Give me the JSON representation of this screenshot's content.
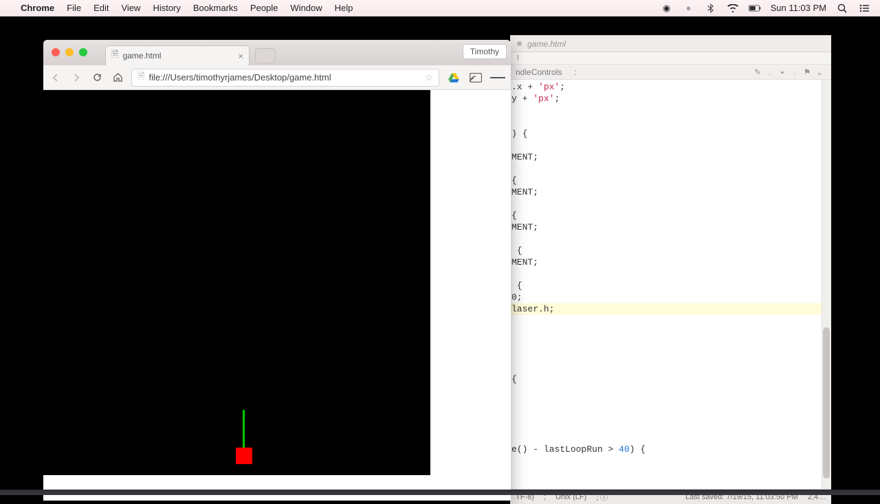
{
  "menubar": {
    "app": "Chrome",
    "items": [
      "File",
      "Edit",
      "View",
      "History",
      "Bookmarks",
      "People",
      "Window",
      "Help"
    ],
    "clock": "Sun 11:03 PM"
  },
  "chrome": {
    "tab_title": "game.html",
    "profile": "Timothy",
    "url": "file:///Users/timothyrjames/Desktop/game.html"
  },
  "editor": {
    "tab": "game.html",
    "breadcrumb": "l",
    "func": "ndleControls",
    "func_sep": ":",
    "code_lines": [
      ".x + 'px';",
      "y + 'px';",
      "",
      "",
      ") {",
      "",
      "MENT;",
      "",
      "{",
      "MENT;",
      "",
      "{",
      "MENT;",
      "",
      " {",
      "MENT;",
      "",
      " {",
      "0;",
      "laser.h;",
      "",
      "",
      "",
      "",
      "",
      "{",
      "",
      "",
      "",
      "",
      "",
      "e() - lastLoopRun > 40) {",
      "",
      ""
    ],
    "highlight_line_index": 19,
    "status": {
      "enc": "TF-8)",
      "sep1": ";",
      "eol": "Unix (LF)",
      "sep2": ";   ⓘ",
      "saved": "Last saved: 7/19/15, 11:03:50 PM",
      "pos": "2,4…"
    }
  }
}
